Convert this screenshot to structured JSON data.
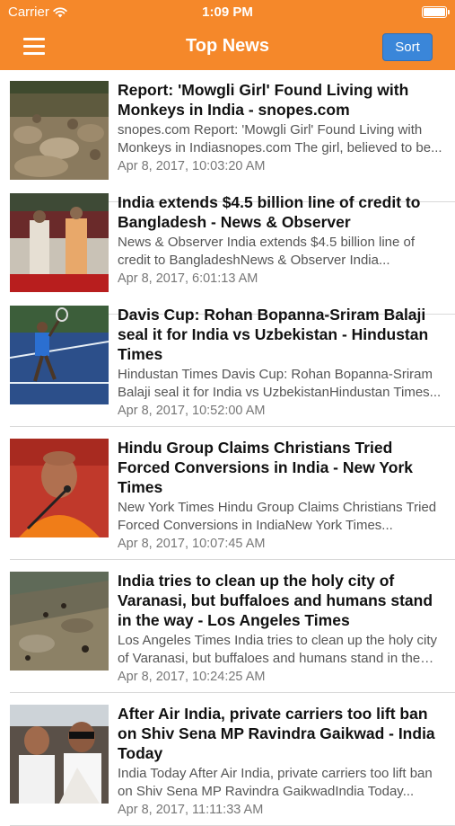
{
  "status_bar": {
    "carrier": "Carrier",
    "time": "1:09 PM"
  },
  "nav": {
    "title": "Top News",
    "sort_label": "Sort"
  },
  "articles": [
    {
      "headline": "Report: 'Mowgli Girl' Found Living with Monkeys in India - snopes.com",
      "snippet": "snopes.com     Report: 'Mowgli Girl' Found Living with Monkeys in Indiasnopes.com  The girl, believed to be...",
      "time": "Apr 8, 2017, 10:03:20 AM"
    },
    {
      "headline": "India extends $4.5 billion line of credit to Bangladesh - News & Observer",
      "snippet": "News & Observer     India extends $4.5 billion line of credit to BangladeshNews & Observer  India...",
      "time": "Apr 8, 2017, 6:01:13 AM"
    },
    {
      "headline": "Davis Cup: Rohan Bopanna-Sriram Balaji seal it for India vs Uzbekistan - Hindustan Times",
      "snippet": "Hindustan Times     Davis Cup: Rohan Bopanna-Sriram Balaji seal it for India vs UzbekistanHindustan Times...",
      "time": "Apr 8, 2017, 10:52:00 AM"
    },
    {
      "headline": "Hindu Group Claims Christians Tried Forced Conversions in India - New York Times",
      "snippet": "New York Times     Hindu Group Claims Christians Tried Forced Conversions in IndiaNew York Times...",
      "time": "Apr 8, 2017, 10:07:45 AM"
    },
    {
      "headline": "India tries to clean up the holy city of Varanasi, but buffaloes and humans stand in the way - Los Angeles Times",
      "snippet": "Los Angeles Times     India tries to clean up the holy city of Varanasi, but buffaloes and humans stand in the way...",
      "time": "Apr 8, 2017, 10:24:25 AM"
    },
    {
      "headline": "After Air India, private carriers too lift ban on Shiv Sena MP Ravindra Gaikwad - India Today",
      "snippet": "India Today     After Air India, private carriers too lift ban on Shiv Sena MP Ravindra GaikwadIndia Today...",
      "time": "Apr 8, 2017, 11:11:33 AM"
    }
  ]
}
